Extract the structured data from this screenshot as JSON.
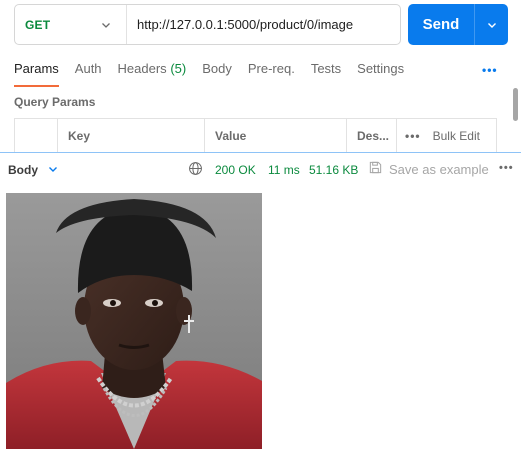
{
  "request": {
    "method": "GET",
    "url": "http://127.0.0.1:5000/product/0/image",
    "send_label": "Send"
  },
  "tabs": [
    {
      "label": "Params"
    },
    {
      "label": "Auth"
    },
    {
      "label": "Headers",
      "count": "(5)"
    },
    {
      "label": "Body"
    },
    {
      "label": "Pre-req."
    },
    {
      "label": "Tests"
    },
    {
      "label": "Settings"
    }
  ],
  "tabs_more": "•••",
  "query_params": {
    "title": "Query Params",
    "columns": {
      "key": "Key",
      "value": "Value",
      "description": "Des...",
      "bulk_edit": "Bulk Edit",
      "bulk_dots": "•••"
    }
  },
  "response": {
    "body_label": "Body",
    "status": "200 OK",
    "time": "11 ms",
    "size": "51.16 KB",
    "save_label": "Save as example",
    "more": "•••"
  },
  "colors": {
    "accent": "#097bed",
    "method_green": "#0b8a3e",
    "active_tab": "#f26b3a"
  }
}
